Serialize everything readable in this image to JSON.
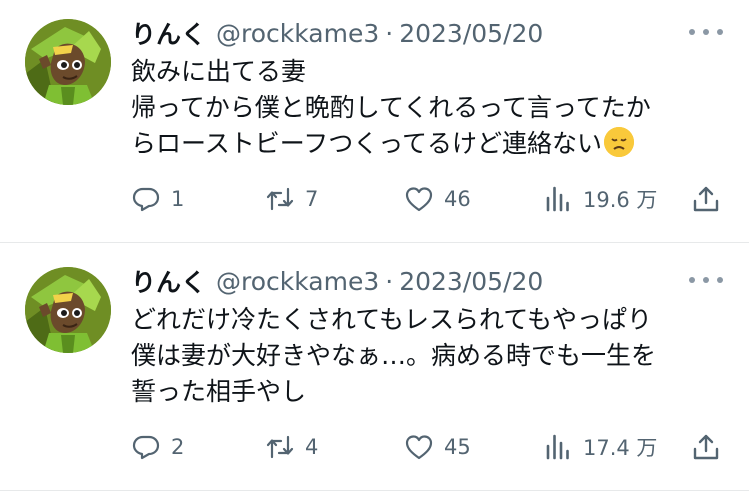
{
  "tweets": [
    {
      "author_name": "りんく",
      "handle": "@rockkame3",
      "separator": "·",
      "date": "2023/05/20",
      "lines": [
        "飲みに出てる妻",
        "帰ってから僕と晩酌してくれるって言ってたか",
        "らローストビーフつくってるけど連絡ない"
      ],
      "emoji": "disappointed-face",
      "replies": "1",
      "retweets": "7",
      "likes": "46",
      "views": "19.6 万"
    },
    {
      "author_name": "りんく",
      "handle": "@rockkame3",
      "separator": "·",
      "date": "2023/05/20",
      "lines": [
        "どれだけ冷たくされてもレスられてもやっぱり",
        "僕は妻が大好きやなぁ…。病める時でも一生を",
        "誓った相手やし"
      ],
      "replies": "2",
      "retweets": "4",
      "likes": "45",
      "views": "17.4 万"
    }
  ],
  "icons": {
    "reply": "speech-bubble-icon",
    "retweet": "retweet-arrows-icon",
    "like": "heart-icon",
    "views": "bar-chart-icon",
    "share": "share-upload-icon",
    "more": "more-dots-icon"
  },
  "colors": {
    "text": "#0f1419",
    "secondary": "#536471",
    "divider": "#e7e9ea",
    "avatar_green": "#8fc63f"
  }
}
